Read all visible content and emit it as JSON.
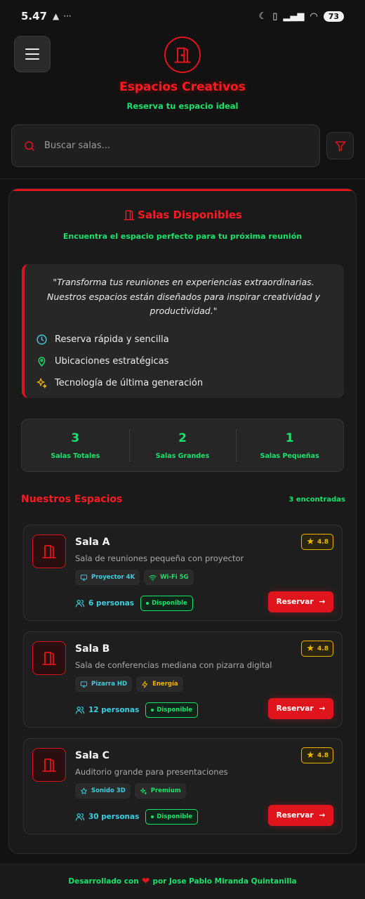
{
  "status_bar": {
    "time": "5.47",
    "battery": "73"
  },
  "header": {
    "title": "Espacios Creativos",
    "subtitle": "Reserva tu espacio ideal"
  },
  "search": {
    "placeholder": "Buscar salas..."
  },
  "section": {
    "title": "Salas Disponibles",
    "subtitle": "Encuentra el espacio perfecto para tu próxima reunión"
  },
  "quote": {
    "text": "\"Transforma tus reuniones en experiencias extraordinarias. Nuestros espacios están diseñados para inspirar creatividad y productividad.\"",
    "features": [
      {
        "icon": "clock-icon",
        "label": "Reserva rápida y sencilla"
      },
      {
        "icon": "map-pin-icon",
        "label": "Ubicaciones estratégicas"
      },
      {
        "icon": "sparkles-icon",
        "label": "Tecnología de última generación"
      }
    ]
  },
  "stats": [
    {
      "value": "3",
      "label": "Salas Totales"
    },
    {
      "value": "2",
      "label": "Salas Grandes"
    },
    {
      "value": "1",
      "label": "Salas Pequeñas"
    }
  ],
  "rooms_header": {
    "title": "Nuestros Espacios",
    "count": "3 encontradas"
  },
  "rooms": [
    {
      "name": "Sala A",
      "description": "Sala de reuniones pequeña con proyector",
      "rating": "4.8",
      "tags": [
        {
          "icon": "monitor-icon",
          "label": "Proyector 4K"
        },
        {
          "icon": "wifi-icon",
          "label": "Wi-Fi 5G"
        }
      ],
      "capacity": "6 personas",
      "status": "Disponible",
      "action": "Reservar"
    },
    {
      "name": "Sala B",
      "description": "Sala de conferencias mediana con pizarra digital",
      "rating": "4.8",
      "tags": [
        {
          "icon": "monitor-icon",
          "label": "Pizarra HD"
        },
        {
          "icon": "bolt-icon",
          "label": "Energía"
        }
      ],
      "capacity": "12 personas",
      "status": "Disponible",
      "action": "Reservar"
    },
    {
      "name": "Sala C",
      "description": "Auditorio grande para presentaciones",
      "rating": "4.8",
      "tags": [
        {
          "icon": "star-outline-icon",
          "label": "Sonido 3D"
        },
        {
          "icon": "sparkles-icon",
          "label": "Premium"
        }
      ],
      "capacity": "30 personas",
      "status": "Disponible",
      "action": "Reservar"
    }
  ],
  "footer": {
    "prefix": "Desarrollado con",
    "suffix": "por Jose Pablo Miranda Quintanilla"
  },
  "colors": {
    "accent_red": "#e0141c",
    "accent_green": "#19e36a",
    "accent_cyan": "#3ad0e0",
    "accent_yellow": "#f0b400",
    "background": "#121212"
  }
}
